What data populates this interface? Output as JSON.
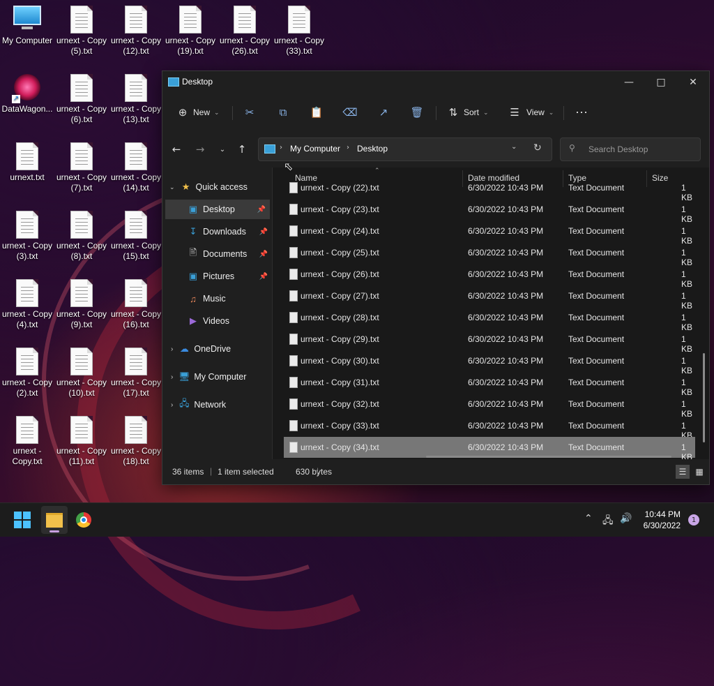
{
  "desktop": {
    "icons": [
      {
        "label": "My Computer",
        "type": "computer"
      },
      {
        "label": "urnext - Copy (5).txt",
        "type": "txt"
      },
      {
        "label": "urnext - Copy (12).txt",
        "type": "txt"
      },
      {
        "label": "urnext - Copy (19).txt",
        "type": "txt"
      },
      {
        "label": "urnext - Copy (26).txt",
        "type": "txt"
      },
      {
        "label": "urnext - Copy (33).txt",
        "type": "txt"
      },
      {
        "label": "DataWagon...",
        "type": "app"
      },
      {
        "label": "urnext - Copy (6).txt",
        "type": "txt"
      },
      {
        "label": "urnext - Copy (13).txt",
        "type": "txt"
      },
      {
        "label": "urnext.txt",
        "type": "txt"
      },
      {
        "label": "urnext - Copy (7).txt",
        "type": "txt"
      },
      {
        "label": "urnext - Copy (14).txt",
        "type": "txt"
      },
      {
        "label": "urnext - Copy (3).txt",
        "type": "txt"
      },
      {
        "label": "urnext - Copy (8).txt",
        "type": "txt"
      },
      {
        "label": "urnext - Copy (15).txt",
        "type": "txt"
      },
      {
        "label": "urnext - Copy (4).txt",
        "type": "txt"
      },
      {
        "label": "urnext - Copy (9).txt",
        "type": "txt"
      },
      {
        "label": "urnext - Copy (16).txt",
        "type": "txt"
      },
      {
        "label": "urnext - Copy (2).txt",
        "type": "txt"
      },
      {
        "label": "urnext - Copy (10).txt",
        "type": "txt"
      },
      {
        "label": "urnext - Copy (17).txt",
        "type": "txt"
      },
      {
        "label": "urnext - Copy.txt",
        "type": "txt"
      },
      {
        "label": "urnext - Copy (11).txt",
        "type": "txt"
      },
      {
        "label": "urnext - Copy (18).txt",
        "type": "txt"
      }
    ]
  },
  "window": {
    "title": "Desktop",
    "toolbar": {
      "new_label": "New",
      "sort_label": "Sort",
      "view_label": "View",
      "icons": [
        "cut-icon",
        "copy-icon",
        "paste-icon",
        "rename-icon",
        "share-icon",
        "delete-icon",
        "more-icon"
      ]
    },
    "address": {
      "segments": [
        "My Computer",
        "Desktop"
      ],
      "search_placeholder": "Search Desktop"
    },
    "nav": {
      "quick_access": "Quick access",
      "items": [
        {
          "label": "Desktop",
          "pinned": true,
          "selected": true
        },
        {
          "label": "Downloads",
          "pinned": true
        },
        {
          "label": "Documents",
          "pinned": true
        },
        {
          "label": "Pictures",
          "pinned": true
        },
        {
          "label": "Music",
          "pinned": false
        },
        {
          "label": "Videos",
          "pinned": false
        }
      ],
      "roots": [
        "OneDrive",
        "My Computer",
        "Network"
      ]
    },
    "columns": {
      "name": "Name",
      "date": "Date modified",
      "type": "Type",
      "size": "Size"
    },
    "files": [
      {
        "name": "urnext - Copy (22).txt",
        "date": "6/30/2022 10:43 PM",
        "type": "Text Document",
        "size": "1 KB"
      },
      {
        "name": "urnext - Copy (23).txt",
        "date": "6/30/2022 10:43 PM",
        "type": "Text Document",
        "size": "1 KB"
      },
      {
        "name": "urnext - Copy (24).txt",
        "date": "6/30/2022 10:43 PM",
        "type": "Text Document",
        "size": "1 KB"
      },
      {
        "name": "urnext - Copy (25).txt",
        "date": "6/30/2022 10:43 PM",
        "type": "Text Document",
        "size": "1 KB"
      },
      {
        "name": "urnext - Copy (26).txt",
        "date": "6/30/2022 10:43 PM",
        "type": "Text Document",
        "size": "1 KB"
      },
      {
        "name": "urnext - Copy (27).txt",
        "date": "6/30/2022 10:43 PM",
        "type": "Text Document",
        "size": "1 KB"
      },
      {
        "name": "urnext - Copy (28).txt",
        "date": "6/30/2022 10:43 PM",
        "type": "Text Document",
        "size": "1 KB"
      },
      {
        "name": "urnext - Copy (29).txt",
        "date": "6/30/2022 10:43 PM",
        "type": "Text Document",
        "size": "1 KB"
      },
      {
        "name": "urnext - Copy (30).txt",
        "date": "6/30/2022 10:43 PM",
        "type": "Text Document",
        "size": "1 KB"
      },
      {
        "name": "urnext - Copy (31).txt",
        "date": "6/30/2022 10:43 PM",
        "type": "Text Document",
        "size": "1 KB"
      },
      {
        "name": "urnext - Copy (32).txt",
        "date": "6/30/2022 10:43 PM",
        "type": "Text Document",
        "size": "1 KB"
      },
      {
        "name": "urnext - Copy (33).txt",
        "date": "6/30/2022 10:43 PM",
        "type": "Text Document",
        "size": "1 KB"
      },
      {
        "name": "urnext - Copy (34).txt",
        "date": "6/30/2022 10:43 PM",
        "type": "Text Document",
        "size": "1 KB",
        "selected": true
      }
    ],
    "status": {
      "count": "36 items",
      "selection": "1 item selected",
      "bytes": "630 bytes"
    }
  },
  "taskbar": {
    "time": "10:44 PM",
    "date": "6/30/2022",
    "notification_count": "1"
  },
  "colors": {
    "accent": "#3aa0d8",
    "selected_row": "#777777",
    "window_bg": "#1f1f1f"
  }
}
